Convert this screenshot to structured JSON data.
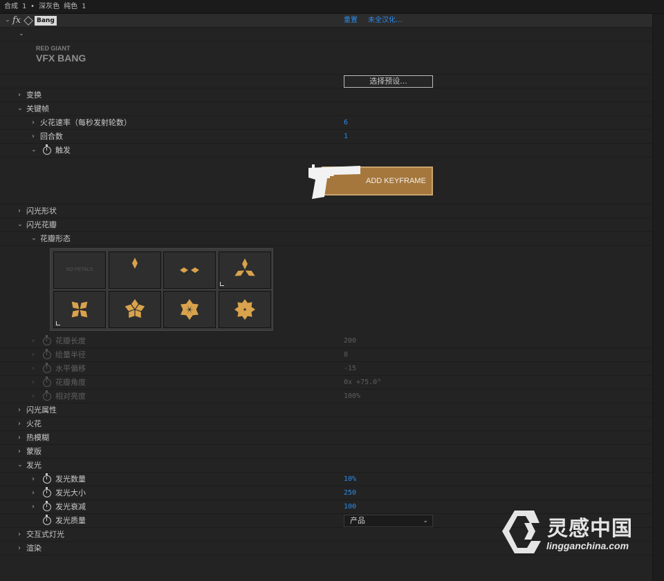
{
  "topbar": {
    "breadcrumb": "合成 1 • 深灰色 纯色 1"
  },
  "effect": {
    "name": "Bang",
    "reset_label": "重置",
    "localize_label": "未全汉化...",
    "logo_sub": "RED GIANT",
    "logo_main": "VFX BANG",
    "preset_button": "选择预设..."
  },
  "rows": {
    "transform": "变换",
    "keyframes": "关键帧",
    "spark_rate": {
      "label": "火花速率（每秒发射轮数）",
      "value": "6"
    },
    "rounds": {
      "label": "回合数",
      "value": "1"
    },
    "trigger": "触发",
    "add_keyframe": "ADD KEYFRAME",
    "flash_shape": "闪光形状",
    "flash_petals": "闪光花瓣",
    "petal_shape": "花瓣形态",
    "no_petals": "NO PETALS",
    "petal_length": {
      "label": "花瓣长度",
      "value": "200"
    },
    "base_radius": {
      "label": "绘量半径",
      "value": "8"
    },
    "horizontal_offset": {
      "label": "水平偏移",
      "value": "-15"
    },
    "petal_angle": {
      "label": "花瓣角度",
      "value": "0x +75.0°"
    },
    "relative_brightness": {
      "label": "相对亮度",
      "value": "100%"
    },
    "flash_properties": "闪光属性",
    "sparks": "火花",
    "heat_haze": "热模糊",
    "mask": "蒙版",
    "glow": "发光",
    "glow_count": {
      "label": "发光数量",
      "value": "10%"
    },
    "glow_size": {
      "label": "发光大小",
      "value": "250"
    },
    "glow_falloff": {
      "label": "发光衰减",
      "value": "100"
    },
    "glow_quality": {
      "label": "发光质量",
      "value": "产品"
    },
    "interactive_light": "交互式灯光",
    "render": "渲染"
  },
  "watermark": {
    "text": "灵感中国",
    "url": "lingganchina.com"
  },
  "colors": {
    "accent_blue": "#2d8ceb",
    "button_gold": "#a5773d",
    "petal_gold": "#d9a24c"
  },
  "icons": [
    "chevron-icon",
    "fx-icon",
    "cube-icon",
    "stopwatch-icon",
    "pistol-icon"
  ]
}
